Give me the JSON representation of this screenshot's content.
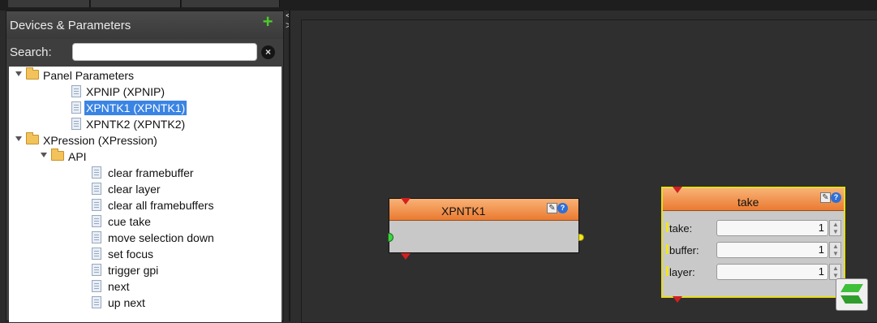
{
  "sidebar": {
    "title": "Devices & Parameters",
    "add_icon": "plus-icon",
    "search_label": "Search:",
    "search_value": "",
    "clear_icon": "clear-search-icon"
  },
  "tree": [
    {
      "label": "Panel Parameters",
      "type": "folder",
      "expanded": true
    },
    {
      "label": "XPNIP (XPNIP)",
      "type": "item"
    },
    {
      "label": "XPNTK1 (XPNTK1)",
      "type": "item",
      "selected": true
    },
    {
      "label": "XPNTK2 (XPNTK2)",
      "type": "item"
    },
    {
      "label": "XPression (XPression)",
      "type": "folder",
      "expanded": true
    },
    {
      "label": "API",
      "type": "folder",
      "expanded": true
    },
    {
      "label": "clear framebuffer",
      "type": "item"
    },
    {
      "label": "clear layer",
      "type": "item"
    },
    {
      "label": "clear all framebuffers",
      "type": "item"
    },
    {
      "label": "cue take",
      "type": "item"
    },
    {
      "label": "move selection down",
      "type": "item"
    },
    {
      "label": "set focus",
      "type": "item"
    },
    {
      "label": "trigger gpi",
      "type": "item"
    },
    {
      "label": "next",
      "type": "item"
    },
    {
      "label": "up next",
      "type": "item"
    }
  ],
  "canvas": {
    "node_xpntk1": {
      "title": "XPNTK1"
    },
    "node_take": {
      "title": "take",
      "params": [
        {
          "name": "take:",
          "value": "1"
        },
        {
          "name": "buffer:",
          "value": "1"
        },
        {
          "name": "layer:",
          "value": "1"
        }
      ]
    }
  },
  "colors": {
    "selection": "#3a84e4",
    "node_header": "#ea7b32",
    "take_border": "#e6de1e",
    "input_port": "#3fd43f",
    "output_port": "#f3e61c",
    "trigger_marker": "#d32020"
  }
}
